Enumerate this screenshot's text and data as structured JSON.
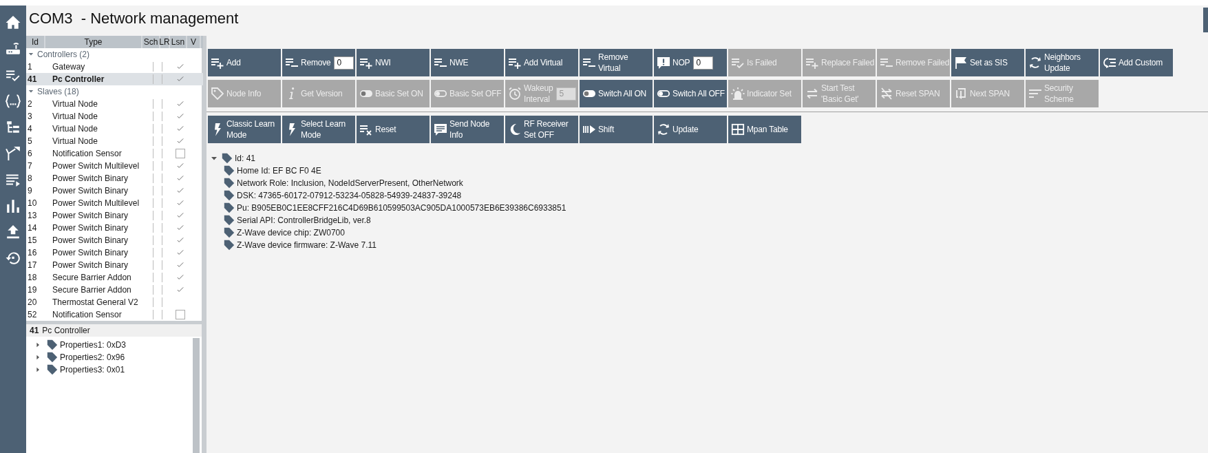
{
  "title": "COM3  - Network management",
  "node_list": {
    "columns": [
      "Id",
      "Type",
      "Sch",
      "LR",
      "Lsn",
      "V"
    ],
    "groups": [
      {
        "label": "Controllers (2)",
        "expanded": true,
        "nodes": [
          {
            "id": "1",
            "type": "Gateway",
            "selected": false,
            "listening": true
          },
          {
            "id": "41",
            "type": "Pc Controller",
            "selected": true,
            "listening": true
          }
        ]
      },
      {
        "label": "Slaves (18)",
        "expanded": true,
        "nodes": [
          {
            "id": "2",
            "type": "Virtual Node",
            "selected": false,
            "listening": true
          },
          {
            "id": "3",
            "type": "Virtual Node",
            "selected": false,
            "listening": true
          },
          {
            "id": "4",
            "type": "Virtual Node",
            "selected": false,
            "listening": true
          },
          {
            "id": "5",
            "type": "Virtual Node",
            "selected": false,
            "listening": true
          },
          {
            "id": "6",
            "type": "Notification Sensor",
            "selected": false,
            "listening": false
          },
          {
            "id": "7",
            "type": "Power Switch Multilevel",
            "selected": false,
            "listening": true
          },
          {
            "id": "8",
            "type": "Power Switch Binary",
            "selected": false,
            "listening": true
          },
          {
            "id": "9",
            "type": "Power Switch Binary",
            "selected": false,
            "listening": true
          },
          {
            "id": "10",
            "type": "Power Switch Multilevel",
            "selected": false,
            "listening": true
          },
          {
            "id": "13",
            "type": "Power Switch Binary",
            "selected": false,
            "listening": true
          },
          {
            "id": "14",
            "type": "Power Switch Binary",
            "selected": false,
            "listening": true
          },
          {
            "id": "15",
            "type": "Power Switch Binary",
            "selected": false,
            "listening": true
          },
          {
            "id": "16",
            "type": "Power Switch Binary",
            "selected": false,
            "listening": true
          },
          {
            "id": "17",
            "type": "Power Switch Binary",
            "selected": false,
            "listening": true
          },
          {
            "id": "18",
            "type": "Secure Barrier Addon",
            "selected": false,
            "listening": true
          },
          {
            "id": "19",
            "type": "Secure Barrier Addon",
            "selected": false,
            "listening": true
          },
          {
            "id": "20",
            "type": "Thermostat General V2",
            "selected": false
          },
          {
            "id": "52",
            "type": "Notification Sensor",
            "selected": false,
            "listening": false
          }
        ]
      }
    ]
  },
  "toolbar_rows": [
    [
      {
        "label": "Add",
        "disabled": false
      },
      {
        "label": "Remove",
        "disabled": false,
        "spinner": "0"
      },
      {
        "label": "NWI",
        "disabled": false
      },
      {
        "label": "NWE",
        "disabled": false
      },
      {
        "label": "Add Virtual",
        "disabled": false
      },
      {
        "label": "Remove\nVirtual",
        "disabled": false
      },
      {
        "label": "NOP",
        "disabled": false,
        "spinner": "0"
      },
      {
        "label": "Is Failed",
        "disabled": true
      },
      {
        "label": "Replace Failed",
        "disabled": true
      },
      {
        "label": "Remove Failed",
        "disabled": true
      },
      {
        "label": "Set as SIS",
        "disabled": false
      },
      {
        "label": "Neighbors\nUpdate",
        "disabled": false
      },
      {
        "label": "Add Custom",
        "disabled": false
      }
    ],
    [
      {
        "label": "Node Info",
        "disabled": true
      },
      {
        "label": "Get Version",
        "disabled": true
      },
      {
        "label": "Basic Set ON",
        "disabled": true
      },
      {
        "label": "Basic Set OFF",
        "disabled": true
      },
      {
        "label": "Wakeup\nInterval",
        "disabled": true,
        "spinner": "5"
      },
      {
        "label": "Switch All ON",
        "disabled": false
      },
      {
        "label": "Switch All OFF",
        "disabled": false
      },
      {
        "label": "Indicator Set",
        "disabled": true
      },
      {
        "label": "Start Test\n'Basic Get'",
        "disabled": true
      },
      {
        "label": "Reset SPAN",
        "disabled": true
      },
      {
        "label": "Next SPAN",
        "disabled": true
      },
      {
        "label": "Security\nScheme",
        "disabled": true
      }
    ],
    [
      {
        "label": "Classic Learn\nMode",
        "disabled": false
      },
      {
        "label": "Select Learn\nMode",
        "disabled": false
      },
      {
        "label": "Reset",
        "disabled": false
      },
      {
        "label": "Send Node\nInfo",
        "disabled": false
      },
      {
        "label": "RF Receiver\nSet OFF",
        "disabled": false
      },
      {
        "label": "Shift",
        "disabled": false
      },
      {
        "label": "Update",
        "disabled": false
      },
      {
        "label": "Mpan Table",
        "disabled": false
      }
    ]
  ],
  "details": {
    "items": [
      {
        "label": "Id: 41",
        "expanded": true,
        "children": [
          {
            "label": "Home Id: EF BC F0 4E"
          },
          {
            "label": "Network Role: Inclusion, NodeIdServerPresent, OtherNetwork"
          },
          {
            "label": "DSK: 47365-60172-07912-53234-05828-54939-24837-39248"
          },
          {
            "label": "Pu: B905EB0C1EE8CFF216C4D69B610599503AC905DA1000573EB6E39386C6933851"
          },
          {
            "label": "Serial API: ControllerBridgeLib, ver.8"
          },
          {
            "label": "Z-Wave device chip: ZW0700"
          },
          {
            "label": "Z-Wave device firmware: Z-Wave 7.11"
          }
        ]
      }
    ]
  },
  "selected_node": {
    "id": "41",
    "type": "Pc Controller",
    "properties": [
      {
        "label": "Properties1: 0xD3",
        "expanded": false
      },
      {
        "label": "Properties2: 0x96",
        "expanded": false
      },
      {
        "label": "Properties3: 0x01",
        "expanded": false
      }
    ]
  }
}
